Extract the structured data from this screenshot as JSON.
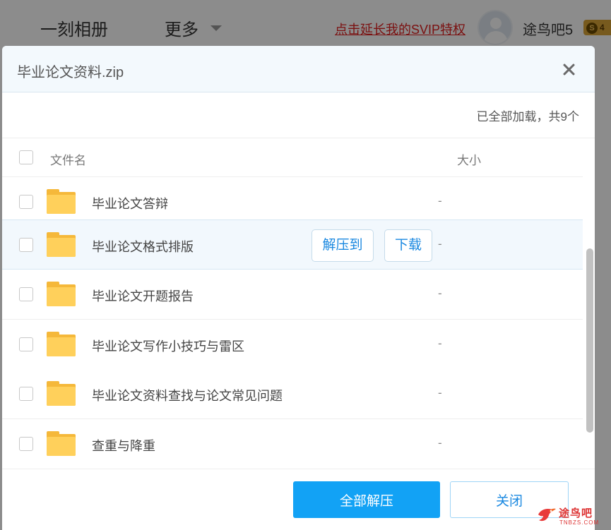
{
  "background": {
    "logo": "一刻相册",
    "more": "更多",
    "promo": "点击延长我的SVIP特权",
    "username": "途鸟吧5",
    "badge": "S",
    "badge_num": "4"
  },
  "dialog": {
    "title": "毕业论文资料.zip",
    "status": "已全部加载，共9个",
    "columns": {
      "name": "文件名",
      "size": "大小"
    },
    "rows": [
      {
        "name": "毕业论文答辩",
        "size": "-"
      },
      {
        "name": "毕业论文格式排版",
        "size": "-",
        "hover": true
      },
      {
        "name": "毕业论文开题报告",
        "size": "-"
      },
      {
        "name": "毕业论文写作小技巧与雷区",
        "size": "-"
      },
      {
        "name": "毕业论文资料查找与论文常见问题",
        "size": "-"
      },
      {
        "name": "查重与降重",
        "size": "-"
      }
    ],
    "row_actions": {
      "extract": "解压到",
      "download": "下载"
    },
    "buttons": {
      "extract_all": "全部解压",
      "close": "关闭"
    }
  },
  "watermark": {
    "name": "途鸟吧",
    "domain": "TNBZS.COM"
  },
  "colors": {
    "accent": "#12a2f5",
    "folder": "#ffd05b",
    "link": "#1a88e0"
  }
}
